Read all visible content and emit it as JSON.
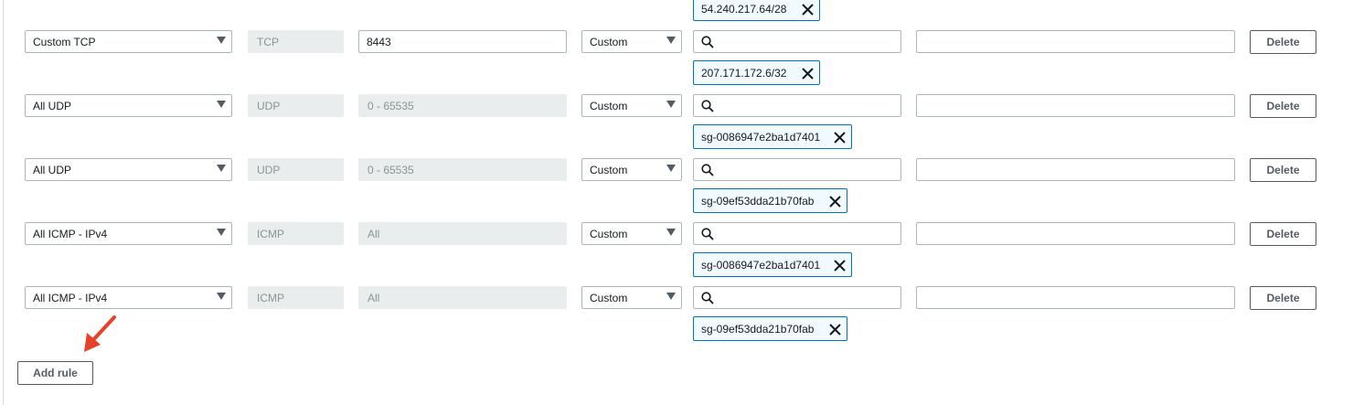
{
  "rules": [
    {
      "type": "Custom TCP",
      "protocol": "TCP",
      "port_range": "8443",
      "source": "Custom",
      "source_value": "",
      "description": "",
      "delete_label": "Delete",
      "token_above": "54.240.217.64/28",
      "token_below": "207.171.172.6/32"
    },
    {
      "type": "All UDP",
      "protocol": "UDP",
      "port_range": "0 - 65535",
      "source": "Custom",
      "source_value": "",
      "description": "",
      "delete_label": "Delete",
      "token_below": "sg-0086947e2ba1d7401"
    },
    {
      "type": "All UDP",
      "protocol": "UDP",
      "port_range": "0 - 65535",
      "source": "Custom",
      "source_value": "",
      "description": "",
      "delete_label": "Delete",
      "token_below": "sg-09ef53dda21b70fab"
    },
    {
      "type": "All ICMP - IPv4",
      "protocol": "ICMP",
      "port_range": "All",
      "source": "Custom",
      "source_value": "",
      "description": "",
      "delete_label": "Delete",
      "token_below": "sg-0086947e2ba1d7401"
    },
    {
      "type": "All ICMP - IPv4",
      "protocol": "ICMP",
      "port_range": "All",
      "source": "Custom",
      "source_value": "",
      "description": "",
      "delete_label": "Delete",
      "token_below": "sg-09ef53dda21b70fab"
    }
  ],
  "add_rule_label": "Add rule",
  "colors": {
    "token_border": "#0073bb",
    "token_bg": "#f1faff",
    "annotation_arrow": "#e8412a"
  },
  "icons": {
    "search": "search-icon",
    "remove": "close-icon",
    "dropdown": "caret-down-icon"
  }
}
